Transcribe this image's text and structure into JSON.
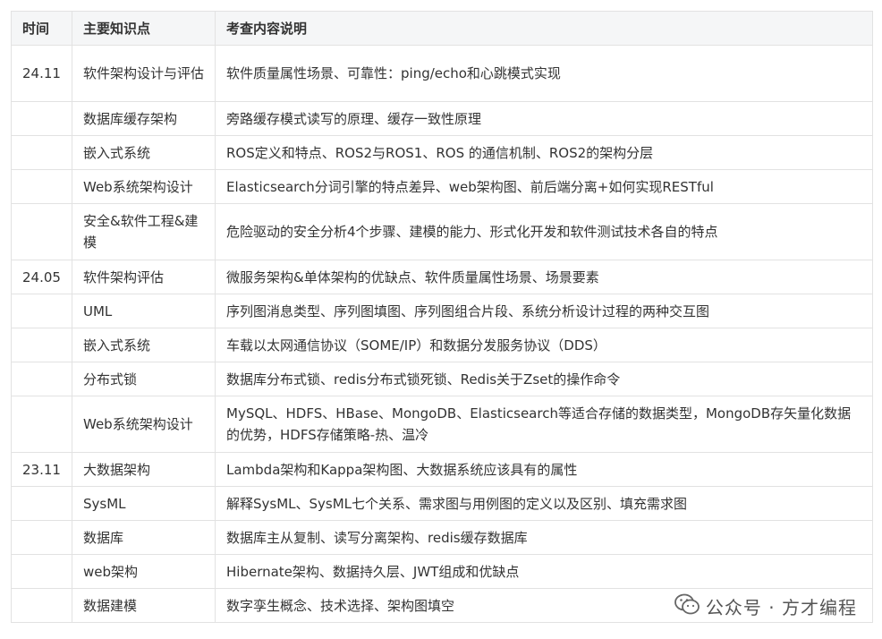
{
  "table": {
    "headers": [
      "时间",
      "主要知识点",
      "考查内容说明"
    ],
    "rows": [
      {
        "time": "24.11",
        "topic": "软件架构设计与评估",
        "content": "软件质量属性场景、可靠性：ping/echo和心跳模式实现"
      },
      {
        "time": "",
        "topic": "数据库缓存架构",
        "content": "旁路缓存模式读写的原理、缓存一致性原理"
      },
      {
        "time": "",
        "topic": "嵌入式系统",
        "content": "ROS定义和特点、ROS2与ROS1、ROS 的通信机制、ROS2的架构分层"
      },
      {
        "time": "",
        "topic": "Web系统架构设计",
        "content": "Elasticsearch分词引擎的特点差异、web架构图、前后端分离+如何实现RESTful"
      },
      {
        "time": "",
        "topic": "安全&软件工程&建模",
        "content": "危险驱动的安全分析4个步骤、建模的能力、形式化开发和软件测试技术各自的特点"
      },
      {
        "time": "24.05",
        "topic": "软件架构评估",
        "content": "微服务架构&单体架构的优缺点、软件质量属性场景、场景要素"
      },
      {
        "time": "",
        "topic": "UML",
        "content": "序列图消息类型、序列图填图、序列图组合片段、系统分析设计过程的两种交互图"
      },
      {
        "time": "",
        "topic": "嵌入式系统",
        "content": "车载以太网通信协议（SOME/IP）和数据分发服务协议（DDS）"
      },
      {
        "time": "",
        "topic": "分布式锁",
        "content": "数据库分布式锁、redis分布式锁死锁、Redis关于Zset的操作命令"
      },
      {
        "time": "",
        "topic": "Web系统架构设计",
        "content": "MySQL、HDFS、HBase、MongoDB、Elasticsearch等适合存储的数据类型，MongoDB存矢量化数据的优势，HDFS存储策略-热、温冷"
      },
      {
        "time": "23.11",
        "topic": "大数据架构",
        "content": "Lambda架构和Kappa架构图、大数据系统应该具有的属性"
      },
      {
        "time": "",
        "topic": "SysML",
        "content": "解释SysML、SysML七个关系、需求图与用例图的定义以及区别、填充需求图"
      },
      {
        "time": "",
        "topic": "数据库",
        "content": "数据库主从复制、读写分离架构、redis缓存数据库"
      },
      {
        "time": "",
        "topic": "web架构",
        "content": "Hibernate架构、数据持久层、JWT组成和优缺点"
      },
      {
        "time": "",
        "topic": "数据建模",
        "content": "数字孪生概念、技术选择、架构图填空"
      }
    ]
  },
  "watermark": {
    "text": "公众号 · 方才编程",
    "icon": "wechat-icon"
  }
}
